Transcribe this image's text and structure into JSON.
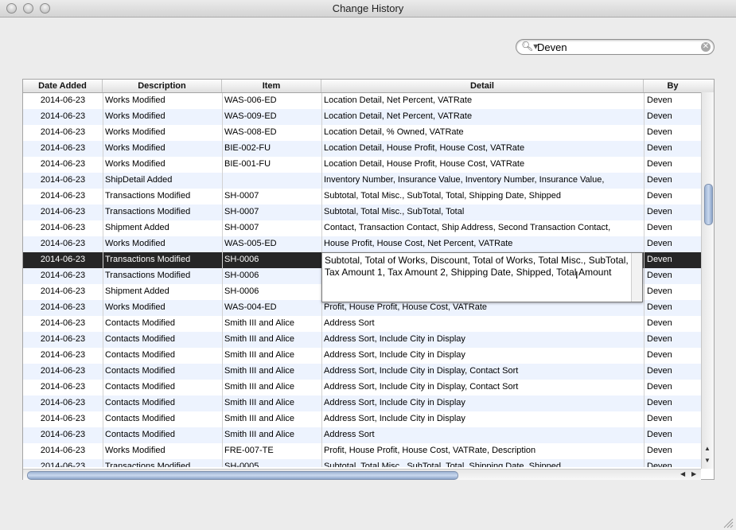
{
  "window": {
    "title": "Change History"
  },
  "search": {
    "value": "Deven"
  },
  "columns": [
    "Date Added",
    "Description",
    "Item",
    "Detail",
    "By"
  ],
  "rows": [
    [
      "2014-06-23",
      "Works Modified",
      "WAS-006-ED",
      "Location Detail, Net Percent, VATRate",
      "Deven"
    ],
    [
      "2014-06-23",
      "Works Modified",
      "WAS-009-ED",
      "Location Detail, Net Percent, VATRate",
      "Deven"
    ],
    [
      "2014-06-23",
      "Works Modified",
      "WAS-008-ED",
      "Location Detail, % Owned, VATRate",
      "Deven"
    ],
    [
      "2014-06-23",
      "Works Modified",
      "BIE-002-FU",
      "Location Detail, House Profit, House Cost, VATRate",
      "Deven"
    ],
    [
      "2014-06-23",
      "Works Modified",
      "BIE-001-FU",
      "Location Detail, House Profit, House Cost, VATRate",
      "Deven"
    ],
    [
      "2014-06-23",
      "ShipDetail Added",
      "",
      "Inventory Number, Insurance Value, Inventory Number, Insurance Value,",
      "Deven"
    ],
    [
      "2014-06-23",
      "Transactions Modified",
      "SH-0007",
      "Subtotal, Total Misc., SubTotal, Total, Shipping Date, Shipped",
      "Deven"
    ],
    [
      "2014-06-23",
      "Transactions Modified",
      "SH-0007",
      "Subtotal, Total Misc., SubTotal, Total",
      "Deven"
    ],
    [
      "2014-06-23",
      "Shipment Added",
      "SH-0007",
      "Contact, Transaction Contact, Ship Address, Second Transaction Contact,",
      "Deven"
    ],
    [
      "2014-06-23",
      "Works Modified",
      "WAS-005-ED",
      "House Profit, House Cost, Net Percent, VATRate",
      "Deven"
    ],
    [
      "2014-06-23",
      "Transactions Modified",
      "SH-0006",
      "",
      "Deven"
    ],
    [
      "2014-06-23",
      "Transactions Modified",
      "SH-0006",
      "",
      "Deven"
    ],
    [
      "2014-06-23",
      "Shipment Added",
      "SH-0006",
      "",
      "Deven"
    ],
    [
      "2014-06-23",
      "Works Modified",
      "WAS-004-ED",
      "Profit, House Profit, House Cost, VATRate",
      "Deven"
    ],
    [
      "2014-06-23",
      "Contacts Modified",
      "Smith III and Alice",
      "Address Sort",
      "Deven"
    ],
    [
      "2014-06-23",
      "Contacts Modified",
      "Smith III and Alice",
      "Address Sort, Include City in Display",
      "Deven"
    ],
    [
      "2014-06-23",
      "Contacts Modified",
      "Smith III and Alice",
      "Address Sort, Include City in Display",
      "Deven"
    ],
    [
      "2014-06-23",
      "Contacts Modified",
      "Smith III and Alice",
      "Address Sort, Include City in Display, Contact Sort",
      "Deven"
    ],
    [
      "2014-06-23",
      "Contacts Modified",
      "Smith III and Alice",
      "Address Sort, Include City in Display, Contact Sort",
      "Deven"
    ],
    [
      "2014-06-23",
      "Contacts Modified",
      "Smith III and Alice",
      "Address Sort, Include City in Display",
      "Deven"
    ],
    [
      "2014-06-23",
      "Contacts Modified",
      "Smith III and Alice",
      "Address Sort, Include City in Display",
      "Deven"
    ],
    [
      "2014-06-23",
      "Contacts Modified",
      "Smith III and Alice",
      "Address Sort",
      "Deven"
    ],
    [
      "2014-06-23",
      "Works Modified",
      "FRE-007-TE",
      "Profit, House Profit, House Cost, VATRate, Description",
      "Deven"
    ],
    [
      "2014-06-23",
      "Transactions Modified",
      "SH-0005",
      "Subtotal, Total Misc., SubTotal, Total, Shipping Date, Shipped",
      "Deven"
    ]
  ],
  "selected_row": 10,
  "editor": {
    "text": "Subtotal, Total of Works, Discount, Total of Works, Total Misc., SubTotal, Tax Amount 1, Tax Amount 2, Shipping Date, Shipped, Total Amount"
  },
  "colors": {
    "selection": "#262626",
    "alt_row": "#edf3fe"
  }
}
